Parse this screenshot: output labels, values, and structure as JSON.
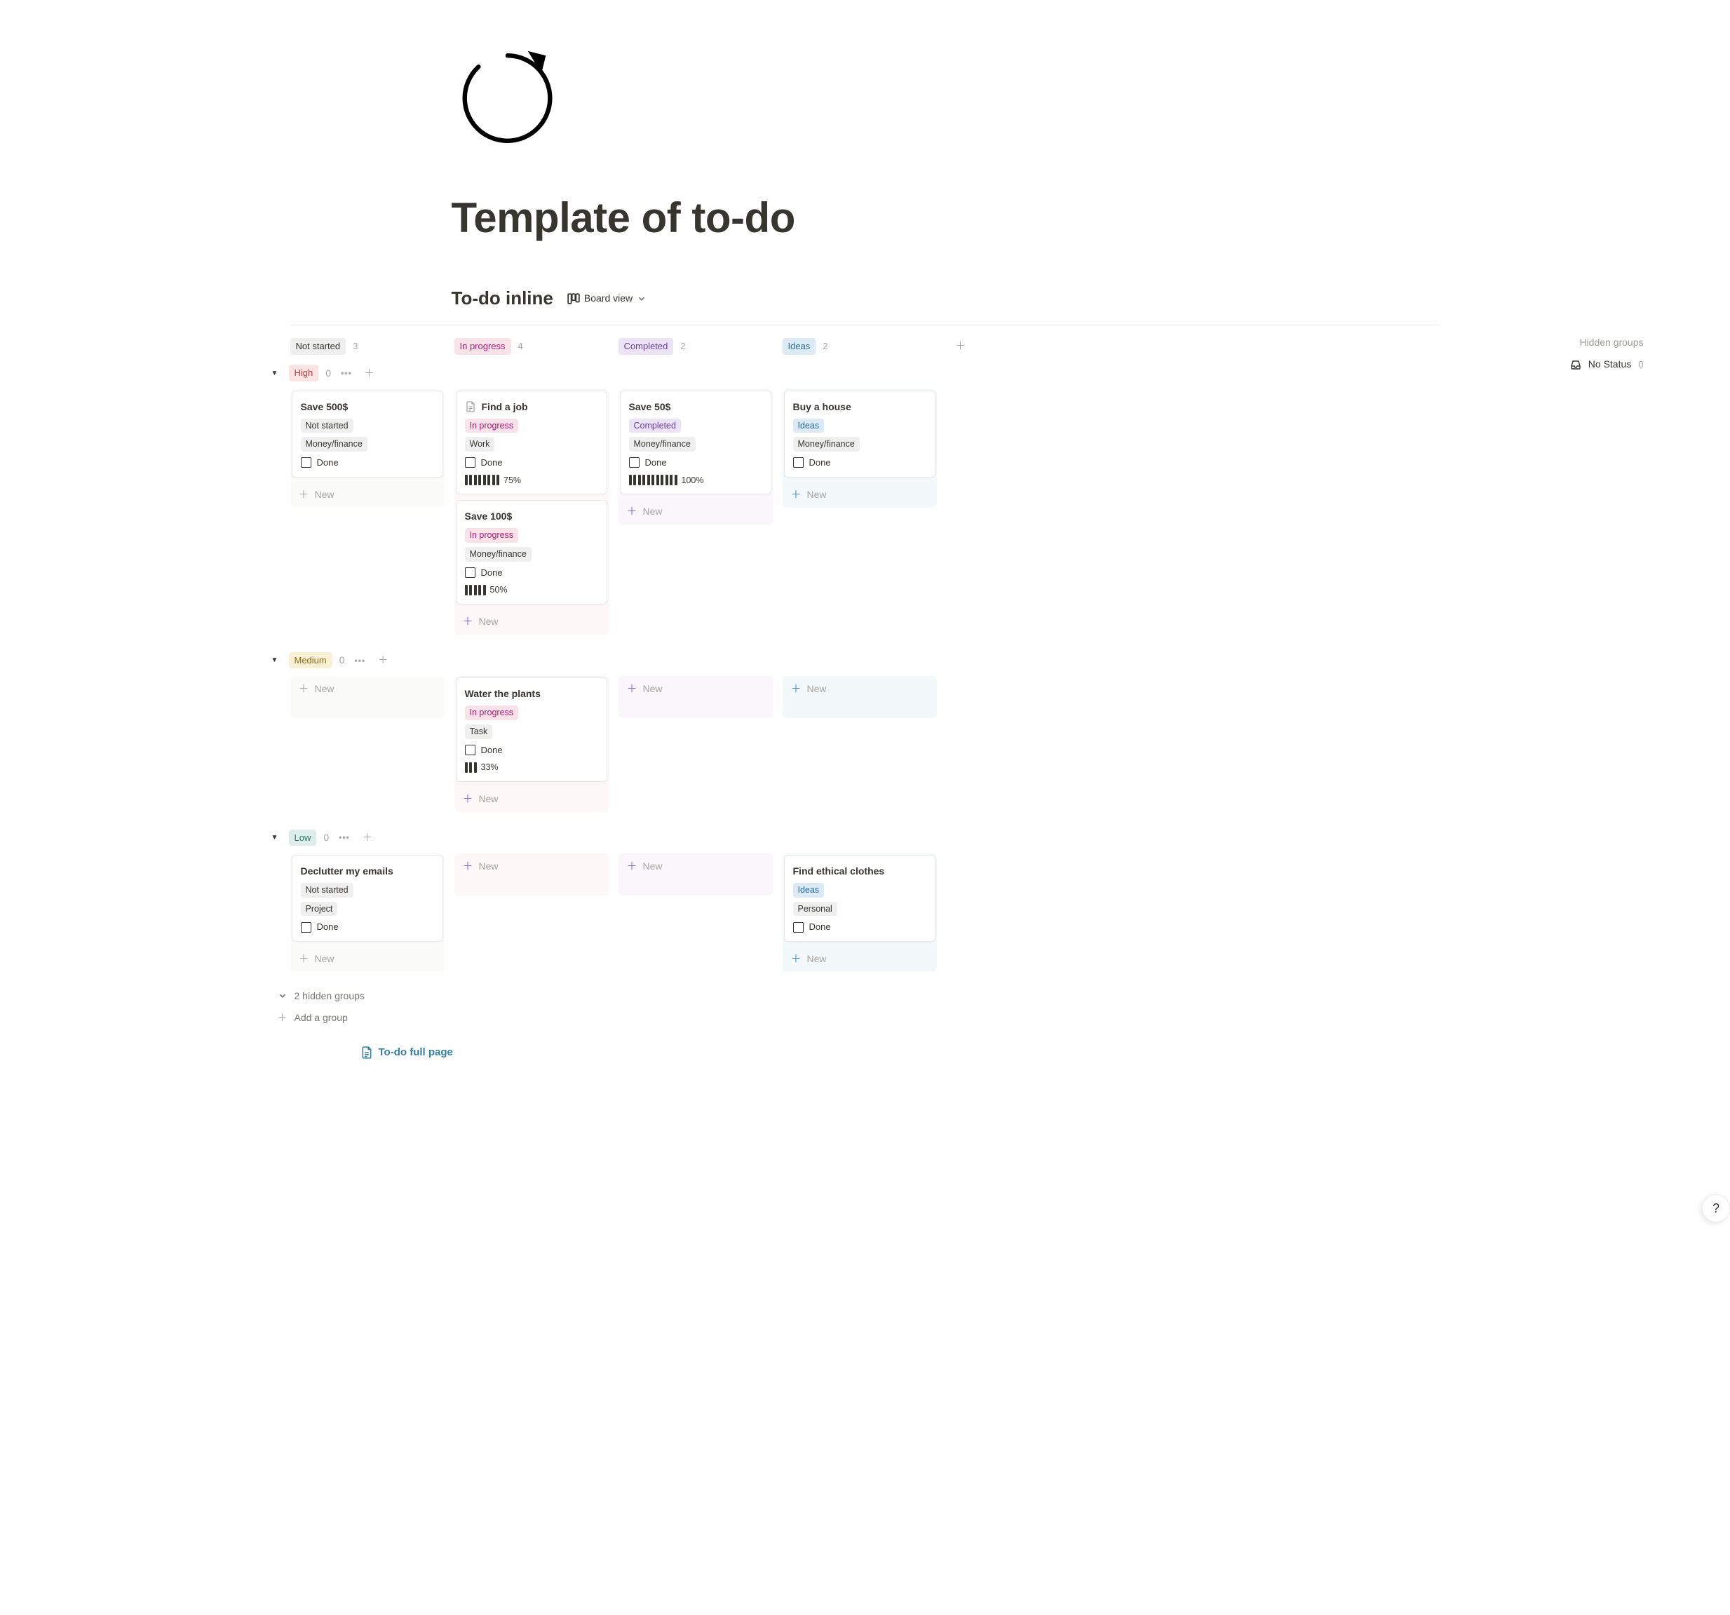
{
  "page": {
    "title": "Template of to-do",
    "database_title": "To-do inline",
    "view_label": "Board view",
    "hidden_groups_label": "Hidden groups",
    "no_status_label": "No Status",
    "no_status_count": "0",
    "hidden_groups_expand": "2 hidden groups",
    "add_group_label": "Add a group",
    "full_page_link": "To-do full page",
    "new_label": "New",
    "done_label": "Done"
  },
  "status_columns": [
    {
      "label": "Not started",
      "count": "3",
      "bg": "bg-default"
    },
    {
      "label": "In progress",
      "count": "4",
      "bg": "bg-pink"
    },
    {
      "label": "Completed",
      "count": "2",
      "bg": "bg-purple"
    },
    {
      "label": "Ideas",
      "count": "2",
      "bg": "bg-blue"
    }
  ],
  "groups": [
    {
      "label": "High",
      "count": "0",
      "bg": "bg-red-soft",
      "columns": [
        {
          "key": "not-started",
          "cards": [
            {
              "title": "Save 500$",
              "status": {
                "label": "Not started",
                "bg": "bg-default"
              },
              "category": {
                "label": "Money/finance",
                "bg": "bg-default"
              },
              "done_label": "Done"
            }
          ]
        },
        {
          "key": "in-progress",
          "cards": [
            {
              "title": "Find a job",
              "icon": "page",
              "status": {
                "label": "In progress",
                "bg": "bg-pink"
              },
              "category": {
                "label": "Work",
                "bg": "bg-default"
              },
              "done_label": "Done",
              "progress": {
                "bars": 8,
                "label": "75%"
              }
            },
            {
              "title": "Save 100$",
              "status": {
                "label": "In progress",
                "bg": "bg-pink"
              },
              "category": {
                "label": "Money/finance",
                "bg": "bg-default"
              },
              "done_label": "Done",
              "progress": {
                "bars": 5,
                "label": "50%"
              }
            }
          ]
        },
        {
          "key": "completed",
          "cards": [
            {
              "title": "Save 50$",
              "status": {
                "label": "Completed",
                "bg": "bg-purple"
              },
              "category": {
                "label": "Money/finance",
                "bg": "bg-default"
              },
              "done_label": "Done",
              "progress": {
                "bars": 11,
                "label": "100%"
              }
            }
          ]
        },
        {
          "key": "ideas",
          "cards": [
            {
              "title": "Buy a house",
              "status": {
                "label": "Ideas",
                "bg": "bg-blue"
              },
              "category": {
                "label": "Money/finance",
                "bg": "bg-default"
              },
              "done_label": "Done"
            }
          ]
        }
      ]
    },
    {
      "label": "Medium",
      "count": "0",
      "bg": "bg-yellow",
      "columns": [
        {
          "key": "not-started",
          "cards": []
        },
        {
          "key": "in-progress",
          "cards": [
            {
              "title": "Water the plants",
              "status": {
                "label": "In progress",
                "bg": "bg-pink"
              },
              "category": {
                "label": "Task",
                "bg": "bg-default"
              },
              "done_label": "Done",
              "progress": {
                "bars": 3,
                "label": "33%"
              }
            }
          ]
        },
        {
          "key": "completed",
          "cards": []
        },
        {
          "key": "ideas",
          "cards": []
        }
      ]
    },
    {
      "label": "Low",
      "count": "0",
      "bg": "bg-green",
      "columns": [
        {
          "key": "not-started",
          "cards": [
            {
              "title": "Declutter my emails",
              "status": {
                "label": "Not started",
                "bg": "bg-default"
              },
              "category": {
                "label": "Project",
                "bg": "bg-default"
              },
              "done_label": "Done"
            }
          ]
        },
        {
          "key": "in-progress",
          "cards": []
        },
        {
          "key": "completed",
          "cards": []
        },
        {
          "key": "ideas",
          "cards": [
            {
              "title": "Find ethical clothes",
              "status": {
                "label": "Ideas",
                "bg": "bg-blue"
              },
              "category": {
                "label": "Personal",
                "bg": "bg-default"
              },
              "done_label": "Done"
            }
          ]
        }
      ]
    }
  ]
}
